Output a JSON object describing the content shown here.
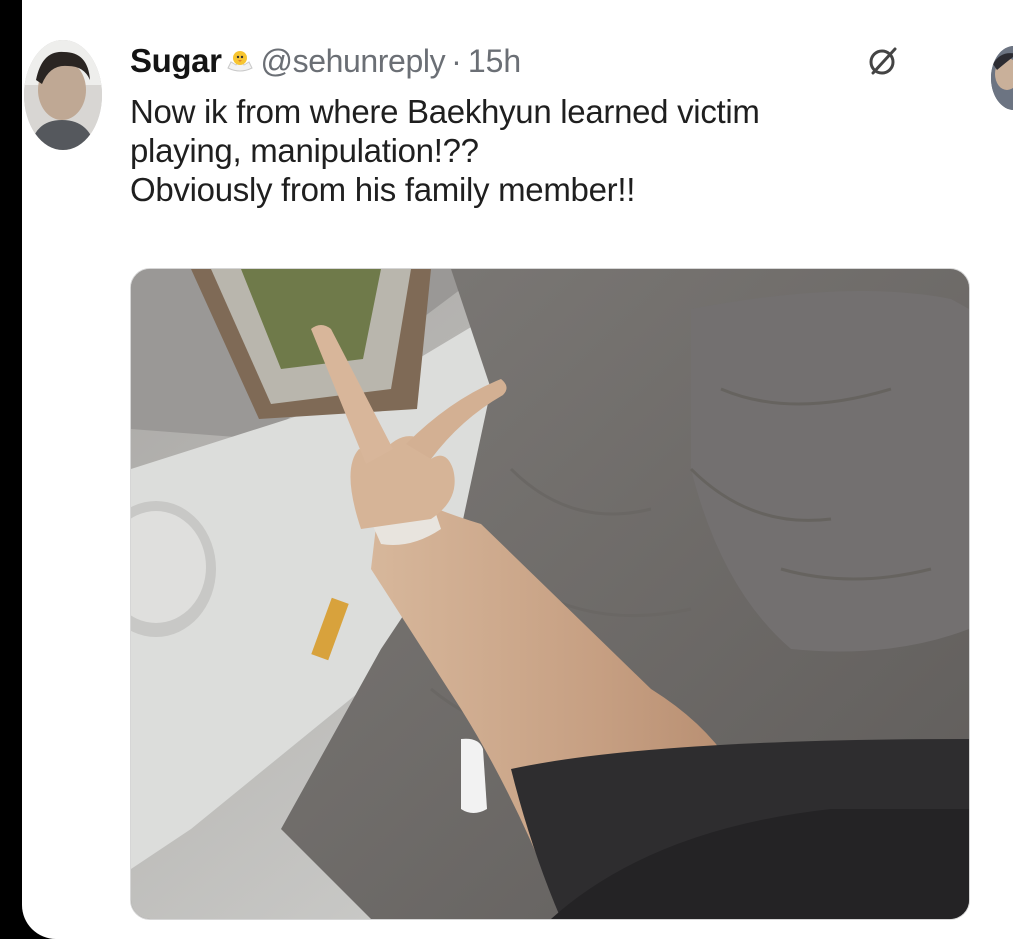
{
  "tweet": {
    "display_name": "Sugar",
    "handle": "@sehunreply",
    "separator": "·",
    "time": "15h",
    "text_lines": [
      "Now ik from where Baekhyun learned victim",
      "playing, manipulation!??",
      "Obviously from his family member!!"
    ]
  },
  "icons": {
    "avatar": "avatar",
    "badge": "chick-emoji-icon",
    "grok": "grok-icon",
    "next_avatar": "avatar"
  },
  "colors": {
    "background": "#000000",
    "card": "#ffffff",
    "name": "#141414",
    "meta": "#6b6f75",
    "text": "#1f1f1f"
  }
}
